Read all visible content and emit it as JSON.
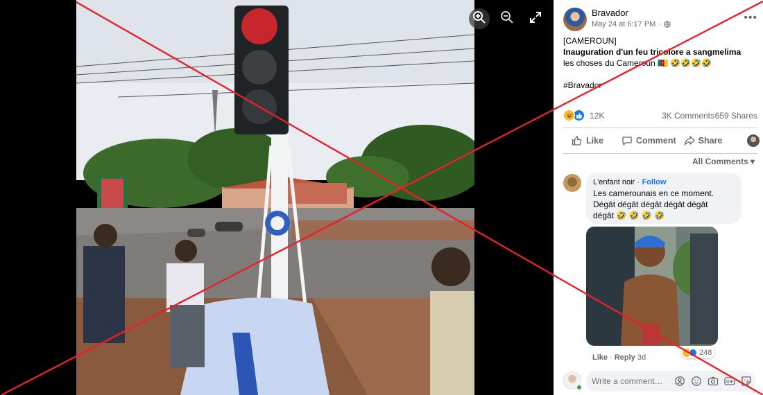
{
  "viewer": {
    "zoom_in_icon": "zoom-in-icon",
    "zoom_out_icon": "zoom-out-icon",
    "fullscreen_icon": "fullscreen-icon"
  },
  "post": {
    "author": "Bravador",
    "date": "May 24 at 6:17 PM",
    "privacy_icon": "globe-icon",
    "tag": "[CAMEROUN]",
    "headline": "Inauguration d'un feu tricolore a sangmelima",
    "text": "les choses du Cameroun",
    "text_emoji": "🇨🇲 🤣🤣🤣🤣",
    "hashtag": "#Bravador"
  },
  "stats": {
    "reactions": "12K",
    "comments": "3K Comments",
    "shares": "659 Shares"
  },
  "actions": {
    "like": "Like",
    "comment": "Comment",
    "share": "Share"
  },
  "comments_section": {
    "sort_label": "All Comments",
    "comment": {
      "author": "L'enfant noir",
      "follow": "Follow",
      "separator": "·",
      "text_line1": "Les camerounais en ce moment.",
      "text_line2": "Dégât dégât dégât dégât dégât",
      "text_line3": "dégât 🤣 🤣 🤣 🤣",
      "reaction_count": "248",
      "like": "Like",
      "reply": "Reply",
      "time": "3d"
    },
    "write_placeholder": "Write a comment…"
  },
  "colors": {
    "accent": "#1877f2",
    "overlay_x": "#e8202a"
  }
}
